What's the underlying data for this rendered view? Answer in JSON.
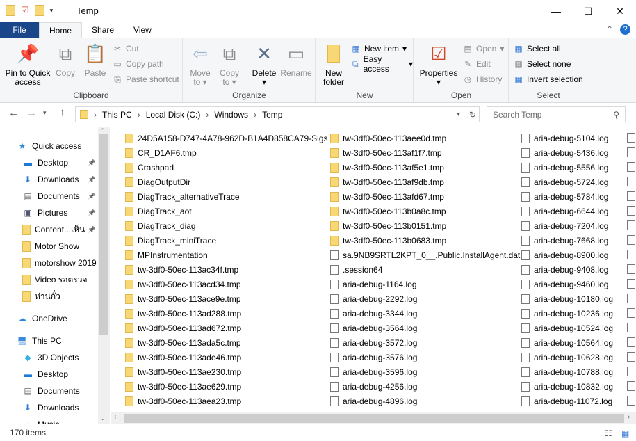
{
  "window": {
    "title": "Temp",
    "minimize": "—",
    "maximize": "☐",
    "close": "✕"
  },
  "ribbon_tabs": [
    "File",
    "Home",
    "Share",
    "View"
  ],
  "clipboard": {
    "label": "Clipboard",
    "pin": "Pin to Quick access",
    "copy": "Copy",
    "paste": "Paste",
    "cut": "Cut",
    "copy_path": "Copy path",
    "paste_shortcut": "Paste shortcut"
  },
  "organize": {
    "label": "Organize",
    "move_to": "Move to",
    "copy_to": "Copy to",
    "delete": "Delete",
    "rename": "Rename"
  },
  "new": {
    "label": "New",
    "new_folder": "New folder",
    "new_item": "New item",
    "easy_access": "Easy access"
  },
  "open": {
    "label": "Open",
    "properties": "Properties",
    "open": "Open",
    "edit": "Edit",
    "history": "History"
  },
  "select": {
    "label": "Select",
    "select_all": "Select all",
    "select_none": "Select none",
    "invert": "Invert selection"
  },
  "address": {
    "crumbs": [
      "This PC",
      "Local Disk (C:)",
      "Windows",
      "Temp"
    ],
    "search_placeholder": "Search Temp"
  },
  "nav": [
    {
      "label": "Quick access",
      "icon": "star",
      "level": 0
    },
    {
      "label": "Desktop",
      "icon": "desktop",
      "level": 1,
      "pin": true
    },
    {
      "label": "Downloads",
      "icon": "download",
      "level": 1,
      "pin": true
    },
    {
      "label": "Documents",
      "icon": "documents",
      "level": 1,
      "pin": true
    },
    {
      "label": "Pictures",
      "icon": "pictures",
      "level": 1,
      "pin": true
    },
    {
      "label": "Content...เห็น",
      "icon": "folder",
      "level": 1,
      "pin": true
    },
    {
      "label": "Motor Show",
      "icon": "folder",
      "level": 1
    },
    {
      "label": "motorshow 2019",
      "icon": "folder",
      "level": 1
    },
    {
      "label": "Video รอตรวจ",
      "icon": "folder",
      "level": 1
    },
    {
      "label": "ห่านกั๋ว",
      "icon": "folder",
      "level": 1
    },
    {
      "label": "OneDrive",
      "icon": "cloud",
      "level": 0,
      "gap": true
    },
    {
      "label": "This PC",
      "icon": "pc",
      "level": 0,
      "gap": true
    },
    {
      "label": "3D Objects",
      "icon": "cube",
      "level": 1
    },
    {
      "label": "Desktop",
      "icon": "desktop",
      "level": 1
    },
    {
      "label": "Documents",
      "icon": "documents",
      "level": 1
    },
    {
      "label": "Downloads",
      "icon": "download",
      "level": 1
    },
    {
      "label": "Music",
      "icon": "music",
      "level": 1
    }
  ],
  "files": [
    [
      {
        "n": "24D5A158-D747-4A78-962D-B1A4D858CA79-Sigs",
        "t": "folder"
      },
      {
        "n": "CR_D1AF6.tmp",
        "t": "folder"
      },
      {
        "n": "Crashpad",
        "t": "folder"
      },
      {
        "n": "DiagOutputDir",
        "t": "folder"
      },
      {
        "n": "DiagTrack_alternativeTrace",
        "t": "folder"
      },
      {
        "n": "DiagTrack_aot",
        "t": "folder"
      },
      {
        "n": "DiagTrack_diag",
        "t": "folder"
      },
      {
        "n": "DiagTrack_miniTrace",
        "t": "folder"
      },
      {
        "n": "MPInstrumentation",
        "t": "folder"
      },
      {
        "n": "tw-3df0-50ec-113ac34f.tmp",
        "t": "folder"
      },
      {
        "n": "tw-3df0-50ec-113acd34.tmp",
        "t": "folder"
      },
      {
        "n": "tw-3df0-50ec-113ace9e.tmp",
        "t": "folder"
      },
      {
        "n": "tw-3df0-50ec-113ad288.tmp",
        "t": "folder"
      },
      {
        "n": "tw-3df0-50ec-113ad672.tmp",
        "t": "folder"
      },
      {
        "n": "tw-3df0-50ec-113ada5c.tmp",
        "t": "folder"
      },
      {
        "n": "tw-3df0-50ec-113ade46.tmp",
        "t": "folder"
      },
      {
        "n": "tw-3df0-50ec-113ae230.tmp",
        "t": "folder"
      },
      {
        "n": "tw-3df0-50ec-113ae629.tmp",
        "t": "folder"
      },
      {
        "n": "tw-3df0-50ec-113aea23.tmp",
        "t": "folder"
      }
    ],
    [
      {
        "n": "tw-3df0-50ec-113aee0d.tmp",
        "t": "folder"
      },
      {
        "n": "tw-3df0-50ec-113af1f7.tmp",
        "t": "folder"
      },
      {
        "n": "tw-3df0-50ec-113af5e1.tmp",
        "t": "folder"
      },
      {
        "n": "tw-3df0-50ec-113af9db.tmp",
        "t": "folder"
      },
      {
        "n": "tw-3df0-50ec-113afd67.tmp",
        "t": "folder"
      },
      {
        "n": "tw-3df0-50ec-113b0a8c.tmp",
        "t": "folder"
      },
      {
        "n": "tw-3df0-50ec-113b0151.tmp",
        "t": "folder"
      },
      {
        "n": "tw-3df0-50ec-113b0683.tmp",
        "t": "folder"
      },
      {
        "n": "sa.9NB9SRTL2KPT_0__.Public.InstallAgent.dat",
        "t": "doc"
      },
      {
        "n": ".session64",
        "t": "doc"
      },
      {
        "n": "aria-debug-1164.log",
        "t": "doc"
      },
      {
        "n": "aria-debug-2292.log",
        "t": "doc"
      },
      {
        "n": "aria-debug-3344.log",
        "t": "doc"
      },
      {
        "n": "aria-debug-3564.log",
        "t": "doc"
      },
      {
        "n": "aria-debug-3572.log",
        "t": "doc"
      },
      {
        "n": "aria-debug-3576.log",
        "t": "doc"
      },
      {
        "n": "aria-debug-3596.log",
        "t": "doc"
      },
      {
        "n": "aria-debug-4256.log",
        "t": "doc"
      },
      {
        "n": "aria-debug-4896.log",
        "t": "doc"
      }
    ],
    [
      {
        "n": "aria-debug-5104.log",
        "t": "doc"
      },
      {
        "n": "aria-debug-5436.log",
        "t": "doc"
      },
      {
        "n": "aria-debug-5556.log",
        "t": "doc"
      },
      {
        "n": "aria-debug-5724.log",
        "t": "doc"
      },
      {
        "n": "aria-debug-5784.log",
        "t": "doc"
      },
      {
        "n": "aria-debug-6644.log",
        "t": "doc"
      },
      {
        "n": "aria-debug-7204.log",
        "t": "doc"
      },
      {
        "n": "aria-debug-7668.log",
        "t": "doc"
      },
      {
        "n": "aria-debug-8900.log",
        "t": "doc"
      },
      {
        "n": "aria-debug-9408.log",
        "t": "doc"
      },
      {
        "n": "aria-debug-9460.log",
        "t": "doc"
      },
      {
        "n": "aria-debug-10180.log",
        "t": "doc"
      },
      {
        "n": "aria-debug-10236.log",
        "t": "doc"
      },
      {
        "n": "aria-debug-10524.log",
        "t": "doc"
      },
      {
        "n": "aria-debug-10564.log",
        "t": "doc"
      },
      {
        "n": "aria-debug-10628.log",
        "t": "doc"
      },
      {
        "n": "aria-debug-10788.log",
        "t": "doc"
      },
      {
        "n": "aria-debug-10832.log",
        "t": "doc"
      },
      {
        "n": "aria-debug-11072.log",
        "t": "doc"
      }
    ]
  ],
  "status": {
    "count": "170 items"
  }
}
